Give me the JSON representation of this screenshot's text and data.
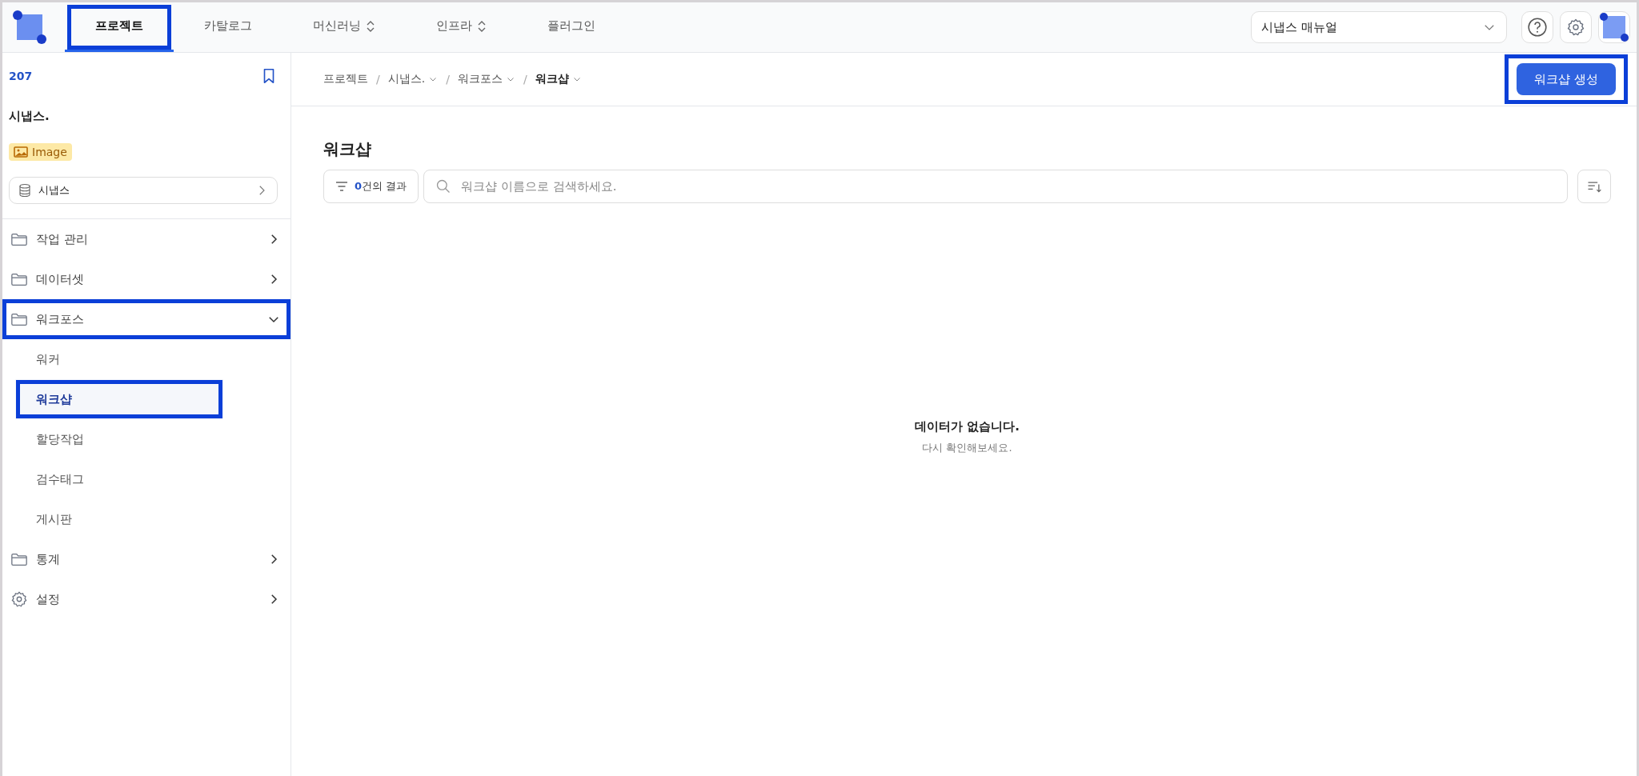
{
  "nav_tabs": [
    {
      "label": "프로젝트",
      "selected": true,
      "highlighted": true,
      "dropdown": false
    },
    {
      "label": "카탈로그",
      "selected": false,
      "highlighted": false,
      "dropdown": false
    },
    {
      "label": "머신러닝",
      "selected": false,
      "highlighted": false,
      "dropdown": true
    },
    {
      "label": "인프라",
      "selected": false,
      "highlighted": false,
      "dropdown": true
    },
    {
      "label": "플러그인",
      "selected": false,
      "highlighted": false,
      "dropdown": false
    }
  ],
  "manual_select": {
    "value": "시냅스 매뉴얼"
  },
  "sidebar": {
    "project_id": "207",
    "project_name": "시냅스.",
    "badge": "Image",
    "dataset": "시냅스",
    "menu": [
      {
        "label": "작업 관리",
        "kind": "folder",
        "expanded": false,
        "highlighted": false
      },
      {
        "label": "데이터셋",
        "kind": "folder",
        "expanded": false,
        "highlighted": false
      },
      {
        "label": "워크포스",
        "kind": "folder",
        "expanded": true,
        "highlighted": true,
        "children": [
          {
            "label": "워커",
            "selected": false,
            "highlighted": false
          },
          {
            "label": "워크샵",
            "selected": true,
            "highlighted": true
          },
          {
            "label": "할당작업",
            "selected": false,
            "highlighted": false
          },
          {
            "label": "검수태그",
            "selected": false,
            "highlighted": false
          },
          {
            "label": "게시판",
            "selected": false,
            "highlighted": false
          }
        ]
      },
      {
        "label": "통계",
        "kind": "folder",
        "expanded": false,
        "highlighted": false
      },
      {
        "label": "설정",
        "kind": "gear",
        "expanded": false,
        "highlighted": false
      }
    ]
  },
  "breadcrumb": [
    {
      "label": "프로젝트",
      "dropdown": false,
      "current": false
    },
    {
      "separator": "/",
      "label": "시냅스.",
      "dropdown": true,
      "current": false
    },
    {
      "separator": "/",
      "label": "워크포스",
      "dropdown": true,
      "current": false
    },
    {
      "separator": "/",
      "label": "워크샵",
      "dropdown": true,
      "current": true
    }
  ],
  "create_button": {
    "label": "워크샵 생성",
    "highlighted": true
  },
  "page_title": "워크샵",
  "result_filter": {
    "count": "0",
    "suffix": "건의 결과"
  },
  "search": {
    "placeholder": "워크샵 이름으로 검색하세요."
  },
  "empty_state": {
    "title": "데이터가 없습니다.",
    "message": "다시 확인해보세요."
  }
}
